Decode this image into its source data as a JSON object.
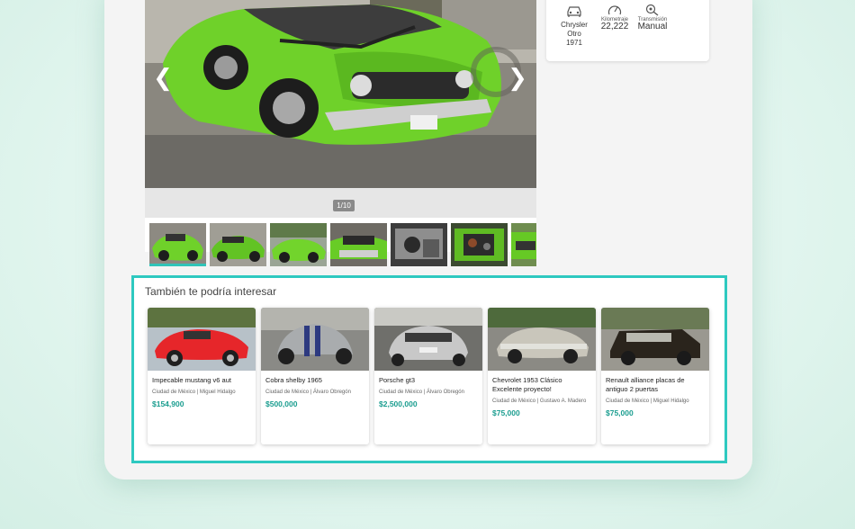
{
  "gallery": {
    "counter": "1/10",
    "prev_icon": "chevron-left-icon",
    "next_icon": "chevron-right-icon",
    "prev_glyph": "❮",
    "next_glyph": "❯",
    "thumbnails": [
      {
        "index": 1,
        "active": true
      },
      {
        "index": 2,
        "active": false
      },
      {
        "index": 3,
        "active": false
      },
      {
        "index": 4,
        "active": false
      },
      {
        "index": 5,
        "active": false
      },
      {
        "index": 6,
        "active": false
      },
      {
        "index": 7,
        "active": false
      }
    ]
  },
  "specs": {
    "car": {
      "icon": "car-icon",
      "line1": "Chrysler",
      "line2": "Otro",
      "line3": "1971"
    },
    "mileage": {
      "icon": "speedometer-icon",
      "label": "Kilometraje",
      "value": "22,222"
    },
    "transmission": {
      "icon": "gearshift-icon",
      "label": "Transmisión",
      "value": "Manual"
    }
  },
  "recommendations": {
    "title": "También te podría interesar",
    "items": [
      {
        "name": "Impecable mustang v6 aut",
        "location": "Ciudad de México | Miguel Hidalgo",
        "price": "$154,900"
      },
      {
        "name": "Cobra shelby 1965",
        "location": "Ciudad de México | Álvaro Obregón",
        "price": "$500,000"
      },
      {
        "name": "Porsche gt3",
        "location": "Ciudad de México | Álvaro Obregón",
        "price": "$2,500,000"
      },
      {
        "name": "Chevrolet 1953 Clásico Excelente proyecto!",
        "location": "Ciudad de México | Gustavo A. Madero",
        "price": "$75,000"
      },
      {
        "name": "Renault alliance placas de antiguo 2 puertas",
        "location": "Ciudad de México | Miguel Hidalgo",
        "price": "$75,000"
      }
    ]
  },
  "colors": {
    "accent": "#2ec9c0",
    "price": "#1a9d8f",
    "car_green": "#6fd12a"
  }
}
